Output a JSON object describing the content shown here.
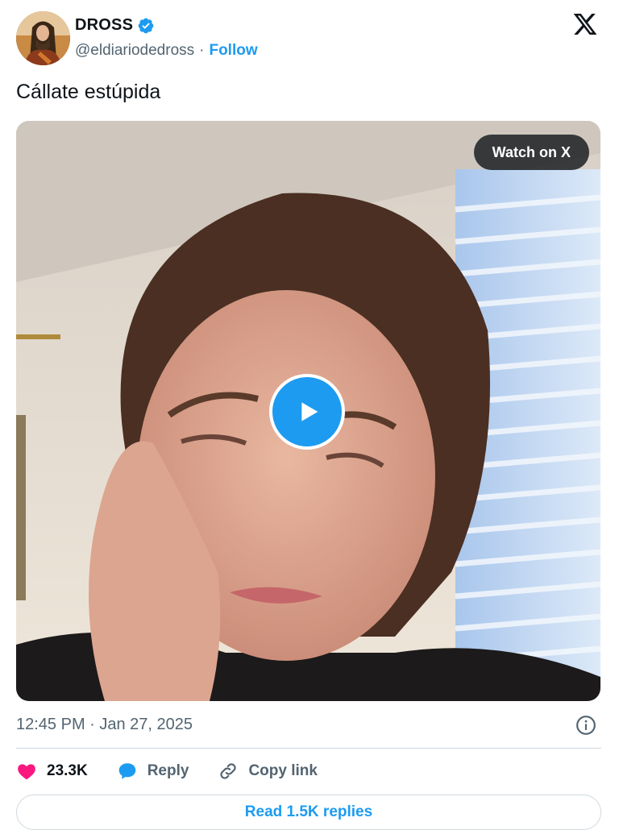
{
  "author": {
    "name": "DROSS",
    "handle": "@eldiariodedross",
    "separator": "·",
    "follow_label": "Follow"
  },
  "tweet": {
    "text": "Cállate estúpida",
    "timestamp": "12:45 PM · Jan 27, 2025"
  },
  "video": {
    "watch_label": "Watch on X"
  },
  "actions": {
    "likes": "23.3K",
    "reply_label": "Reply",
    "copy_link_label": "Copy link"
  },
  "replies_button": "Read 1.5K replies",
  "colors": {
    "accent": "#1d9bf0",
    "like": "#f91880",
    "secondary_text": "#536471"
  }
}
